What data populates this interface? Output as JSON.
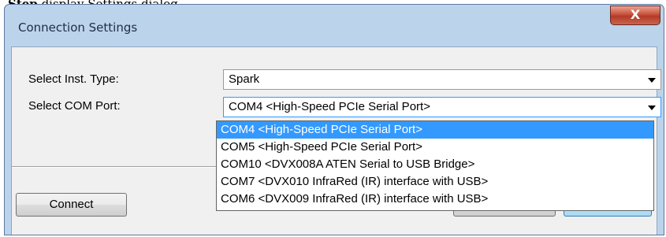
{
  "doc": {
    "bold_prefix": "Step",
    "text": "                                                  display                    Settings dialog"
  },
  "window": {
    "title": "Connection Settings",
    "close_glyph": "X"
  },
  "form": {
    "inst_type_label": "Select Inst. Type:",
    "inst_type_value": "Spark",
    "com_port_label": "Select COM Port:",
    "com_port_value": "COM4 <High-Speed PCIe Serial Port>"
  },
  "buttons": {
    "connect": "Connect"
  },
  "dropdown": {
    "options": [
      "COM4 <High-Speed PCIe Serial Port>",
      "COM5 <High-Speed PCIe Serial Port>",
      "COM10 <DVX008A ATEN Serial to USB Bridge>",
      "COM7 <DVX010 InfraRed (IR) interface with USB>",
      "COM6 <DVX009 InfraRed (IR) interface with USB>"
    ],
    "selected_index": 0
  },
  "colors": {
    "selection": "#3399ff",
    "close_button": "#c8513c",
    "frame": "#bcd3ec"
  }
}
